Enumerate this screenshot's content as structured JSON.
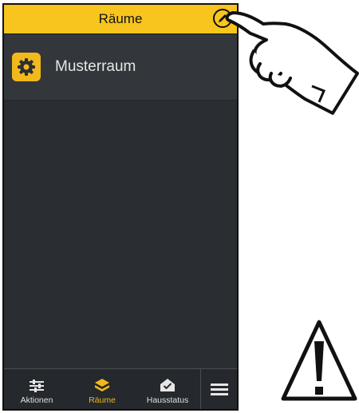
{
  "header": {
    "title": "Räume",
    "edit_button": "pencil-icon"
  },
  "rooms": [
    {
      "label": "Musterraum",
      "icon": "gear-icon"
    }
  ],
  "tabs": [
    {
      "label": "Aktionen",
      "icon": "sliders-icon",
      "active": false
    },
    {
      "label": "Räume",
      "icon": "house-stack-icon",
      "active": true
    },
    {
      "label": "Hausstatus",
      "icon": "house-check-icon",
      "active": false
    }
  ],
  "menu_button": "hamburger-icon",
  "colors": {
    "accent": "#f7c51e",
    "background": "#2c2f33",
    "active_tab": "#f2b91c"
  }
}
